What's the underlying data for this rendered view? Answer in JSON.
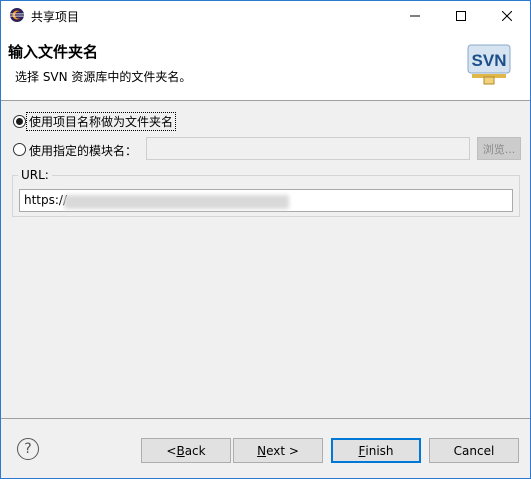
{
  "window": {
    "title": "共享项目",
    "minimize_label": "—",
    "maximize_label": "□",
    "close_label": "✕"
  },
  "banner": {
    "title": "输入文件夹名",
    "description": "选择 SVN 资源库中的文件夹名。",
    "logo_text": "SVN"
  },
  "options": {
    "use_project_name": "使用项目名称做为文件夹名",
    "use_specified_module": "使用指定的模块名：",
    "module_value": "",
    "browse_label": "浏览..."
  },
  "url": {
    "legend": "URL:",
    "value": "https://"
  },
  "footer": {
    "back": {
      "prefix": "< ",
      "mnemonic": "B",
      "rest": "ack"
    },
    "next": {
      "mnemonic": "N",
      "rest": "ext >"
    },
    "finish": {
      "mnemonic": "F",
      "rest": "inish"
    },
    "cancel": "Cancel",
    "help": "?"
  },
  "colors": {
    "accent": "#0078d7",
    "window_border": "#2b79d0"
  }
}
